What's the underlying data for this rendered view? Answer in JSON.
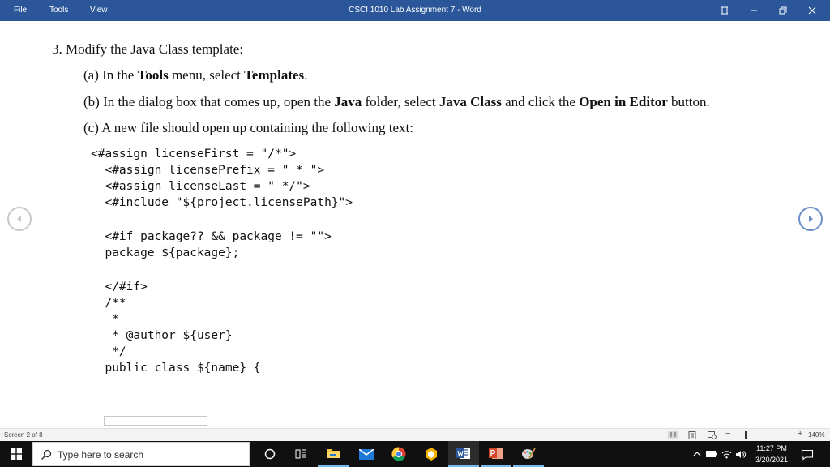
{
  "titlebar": {
    "menu": [
      "File",
      "Tools",
      "View"
    ],
    "title": "CSCI 1010 Lab Assignment 7  -  Word"
  },
  "document": {
    "step": {
      "number": "3.",
      "text": "Modify the Java Class template:"
    },
    "sub_a": {
      "label": "(a)",
      "parts": [
        "In the ",
        "Tools",
        " menu, select ",
        "Templates",
        "."
      ]
    },
    "sub_b": {
      "label": "(b)",
      "parts": [
        "In the dialog box that comes up, open the ",
        "Java",
        " folder, select ",
        "Java Class",
        " and click the ",
        "Open in Editor",
        " button."
      ]
    },
    "sub_c": {
      "label": "(c)",
      "text": "A new file should open up containing the following text:"
    },
    "code": [
      "<#assign licenseFirst = \"/*\">",
      "  <#assign licensePrefix = \" * \">",
      "  <#assign licenseLast = \" */\">",
      "  <#include \"${project.licensePath}\">",
      "",
      "  <#if package?? && package != \"\">",
      "  package ${package};",
      "",
      "  </#if>",
      "  /**",
      "   *",
      "   * @author ${user}",
      "   */",
      "  public class ${name} {"
    ]
  },
  "statusbar": {
    "screen": "Screen 2 of 8",
    "zoom_minus": "−",
    "zoom_plus": "+",
    "zoom": "140%",
    "zoom_fraction": 0.2
  },
  "taskbar": {
    "search_placeholder": "Type here to search",
    "time": "11:27 PM",
    "date": "3/20/2021"
  },
  "colors": {
    "title_bar": "#2b579a",
    "taskbar": "#101010",
    "status_bar": "#f3f3f3"
  },
  "icons": {
    "start": "windows-start-icon",
    "search": "search-icon",
    "cortana": "cortana-icon",
    "task_view": "task-view-icon",
    "explorer": "file-explorer-icon",
    "mail": "mail-icon",
    "chrome": "chrome-icon",
    "app": "hexagon-app-icon",
    "word": "word-icon",
    "powerpoint": "powerpoint-icon",
    "paint": "paint-icon"
  }
}
